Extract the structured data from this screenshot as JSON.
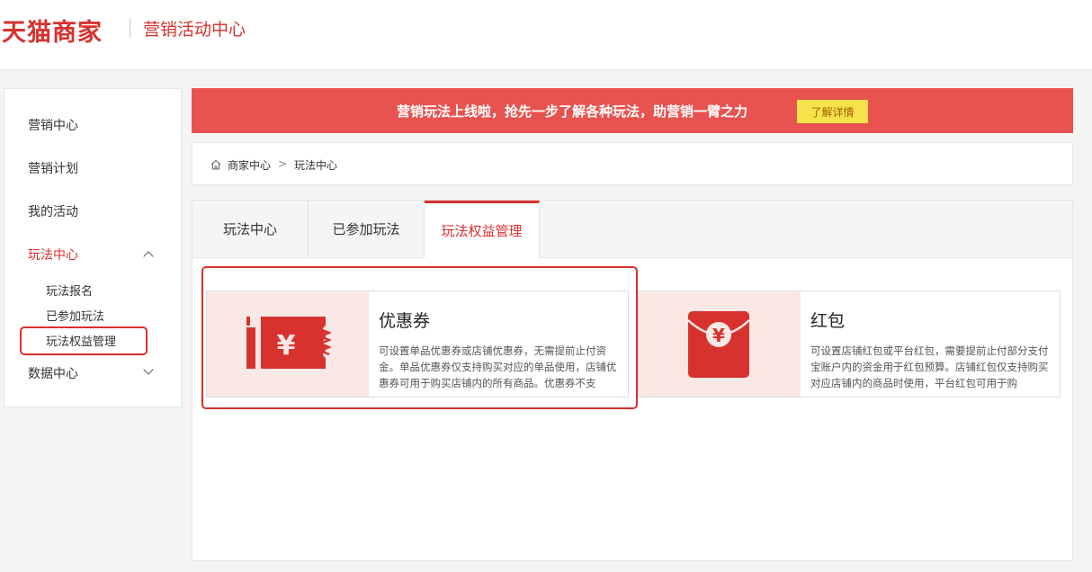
{
  "header": {
    "logo": "天猫商家",
    "title": "营销活动中心"
  },
  "sidebar": {
    "items": [
      {
        "label": "营销中心"
      },
      {
        "label": "营销计划"
      },
      {
        "label": "我的活动"
      },
      {
        "label": "玩法中心",
        "expanded": true
      },
      {
        "label": "数据中心",
        "expanded": false
      }
    ],
    "sub_items": [
      {
        "label": "玩法报名"
      },
      {
        "label": "已参加玩法"
      },
      {
        "label": "玩法权益管理"
      }
    ]
  },
  "banner": {
    "text": "营销玩法上线啦，抢先一步了解各种玩法，助营销一臂之力",
    "button": "了解详情"
  },
  "breadcrumb": {
    "home": "商家中心",
    "separator": ">",
    "current": "玩法中心"
  },
  "tabs": [
    {
      "label": "玩法中心"
    },
    {
      "label": "已参加玩法"
    },
    {
      "label": "玩法权益管理",
      "active": true
    }
  ],
  "cards": [
    {
      "title": "优惠券",
      "icon": "coupon-icon",
      "description": "可设置单品优惠券或店铺优惠券，无需提前止付资金。单品优惠券仅支持购买对应的单品使用，店铺优惠券可用于购买店铺内的所有商品。优惠券不支"
    },
    {
      "title": "红包",
      "icon": "red-envelope-icon",
      "description": "可设置店铺红包或平台红包，需要提前止付部分支付宝账户内的资金用于红包预算。店铺红包仅支持购买对应店铺内的商品时使用，平台红包可用于购"
    }
  ],
  "colors": {
    "brand": "#d8322e",
    "banner": "#e9534f",
    "banner_button": "#f6e34b",
    "card_image_bg": "#fae8e6"
  }
}
